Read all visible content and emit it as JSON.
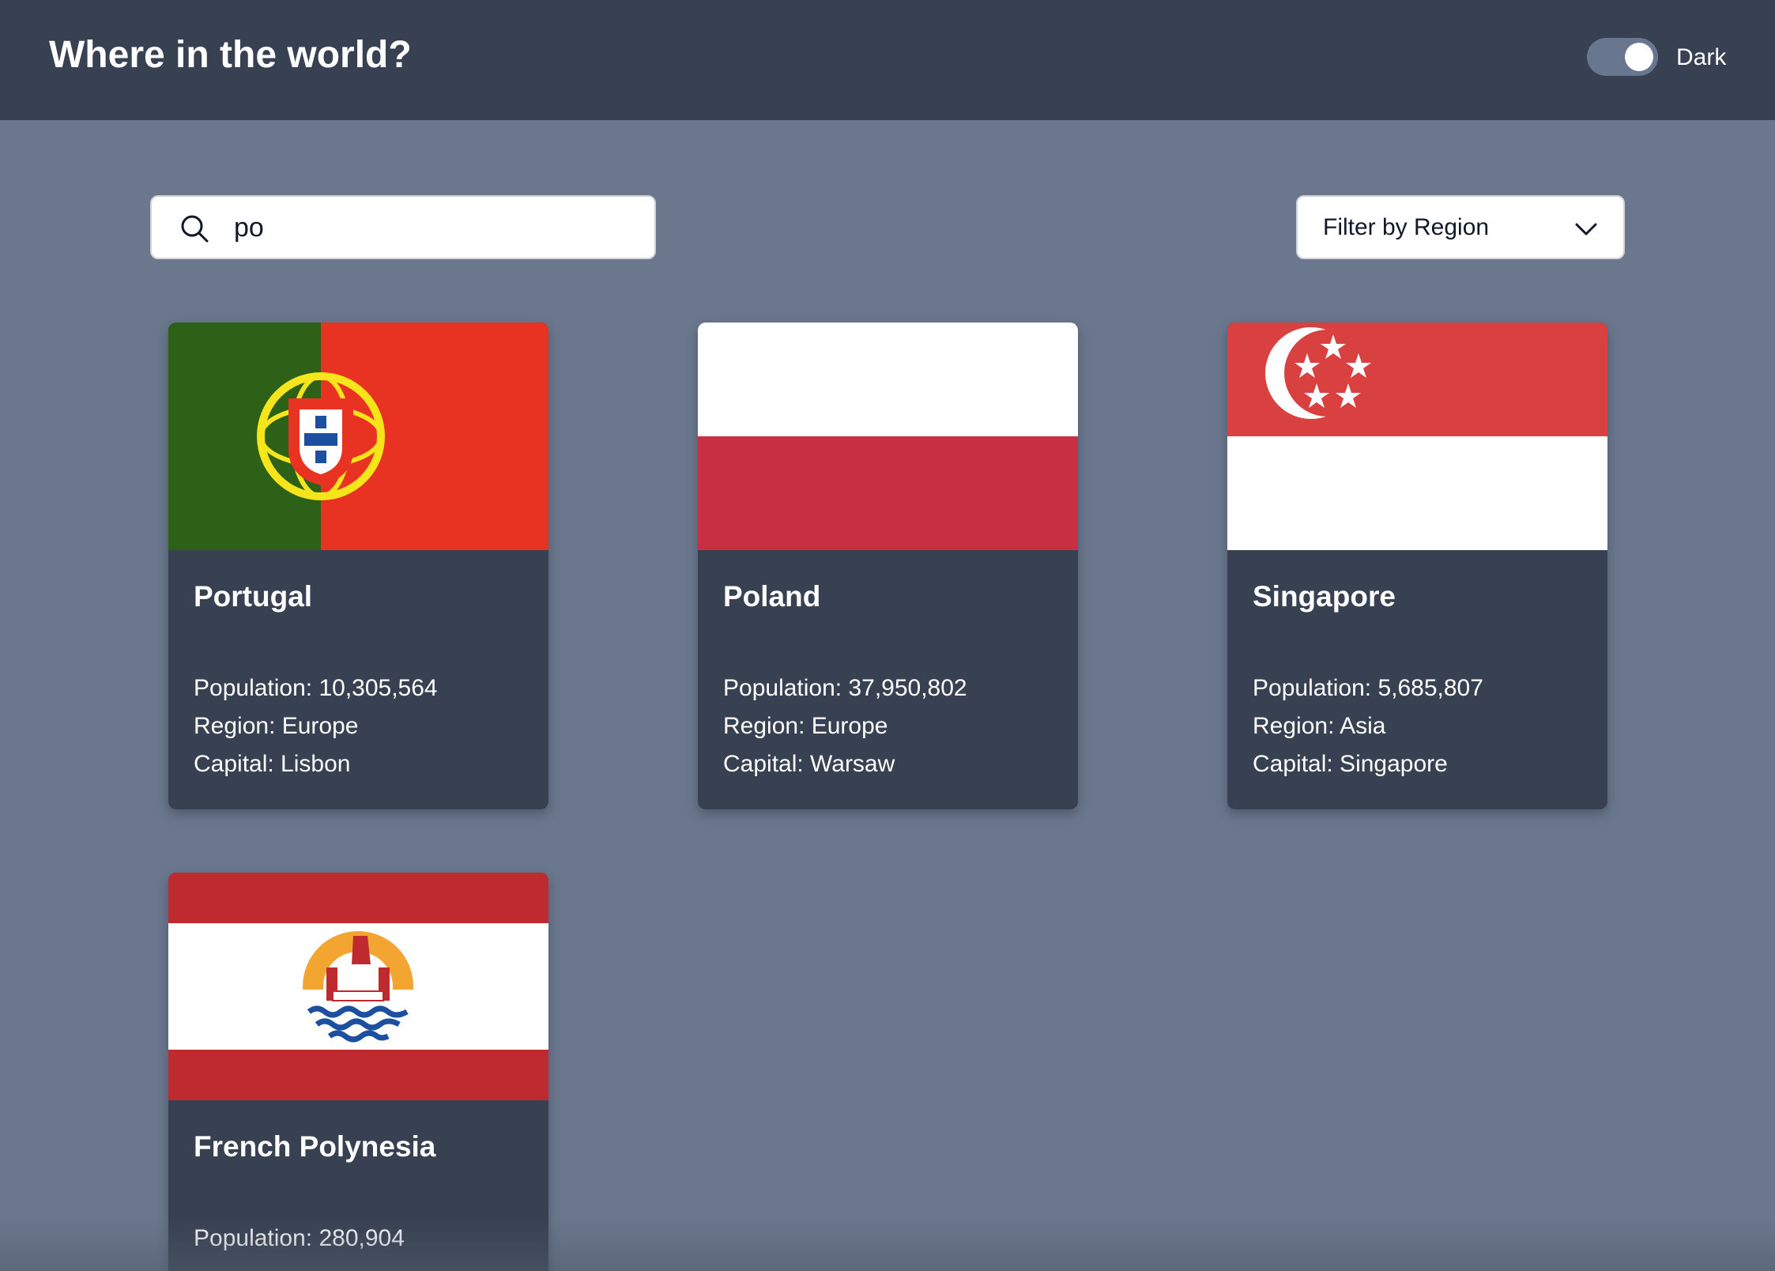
{
  "header": {
    "title": "Where in the world?",
    "theme_toggle_label": "Dark",
    "theme_toggle_on": true
  },
  "search": {
    "value": "po",
    "icon": "search-icon"
  },
  "filter": {
    "label": "Filter by Region",
    "icon": "chevron-down-icon"
  },
  "countries": [
    {
      "name": "Portugal",
      "population": "Population: 10,305,564",
      "region": "Region: Europe",
      "capital": "Capital: Lisbon",
      "flag": "portugal-flag",
      "colors": [
        "#2d6118",
        "#e83323",
        "#f5e51a"
      ]
    },
    {
      "name": "Poland",
      "population": "Population: 37,950,802",
      "region": "Region: Europe",
      "capital": "Capital: Warsaw",
      "flag": "poland-flag",
      "colors": [
        "#ffffff",
        "#c82f41"
      ]
    },
    {
      "name": "Singapore",
      "population": "Population: 5,685,807",
      "region": "Region: Asia",
      "capital": "Capital: Singapore",
      "flag": "singapore-flag",
      "colors": [
        "#d94040",
        "#ffffff"
      ]
    },
    {
      "name": "French Polynesia",
      "population": "Population: 280,904",
      "region": "",
      "capital": "",
      "flag": "french-polynesia-flag",
      "colors": [
        "#bf2a2f",
        "#ffffff",
        "#f3a531",
        "#1d4fa1"
      ]
    }
  ],
  "theme": {
    "background": "#6a778c",
    "header": "#374151",
    "card": "#374151",
    "text": "#ffffff"
  }
}
